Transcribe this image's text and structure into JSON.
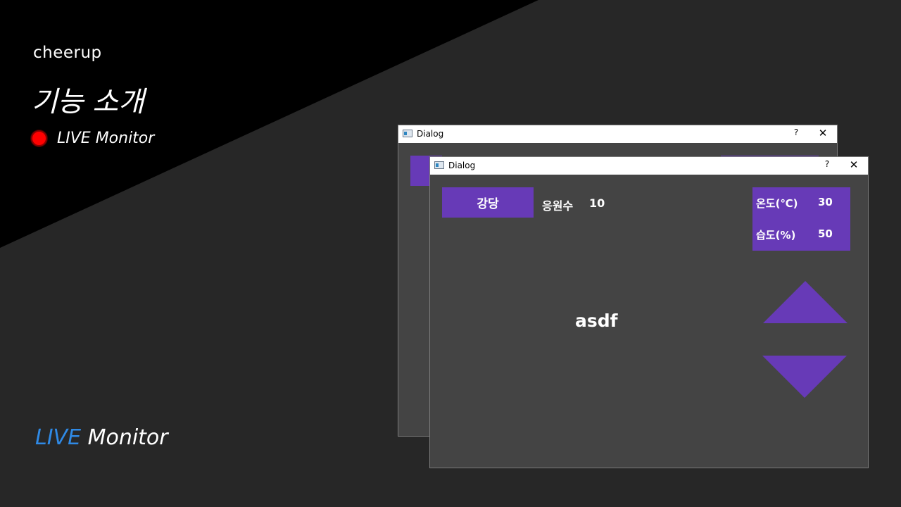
{
  "slide": {
    "brand": "cheerup",
    "title": "기능 소개",
    "live_tag": "LIVE Monitor",
    "footer": {
      "live": "LIVE",
      "monitor": " Monitor"
    },
    "colors": {
      "accent_blue": "#2f8ae6",
      "live_red": "#ff0000",
      "purple": "#673ab7"
    }
  },
  "dialog_back": {
    "title": "Dialog",
    "help": "?",
    "close": "✕"
  },
  "dialog_front": {
    "title": "Dialog",
    "help": "?",
    "close": "✕",
    "location_button": "강당",
    "cheer_label": "응원수",
    "cheer_value": "10",
    "temperature_label": "온도(℃)",
    "temperature_value": "30",
    "humidity_label": "습도(%)",
    "humidity_value": "50",
    "center_text": "asdf",
    "up_icon": "triangle-up-icon",
    "down_icon": "triangle-down-icon"
  }
}
